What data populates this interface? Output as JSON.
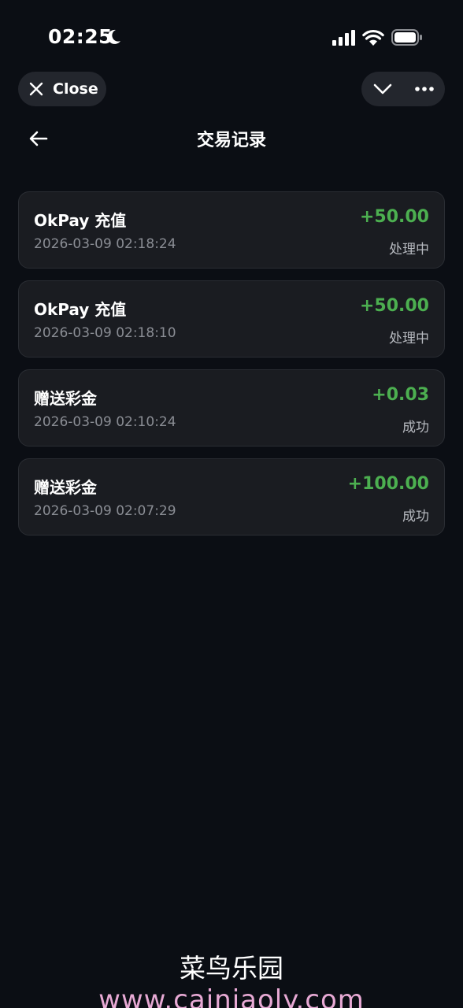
{
  "status_bar": {
    "time": "02:25"
  },
  "top_bar": {
    "close_label": "Close"
  },
  "header": {
    "title": "交易记录"
  },
  "transactions": [
    {
      "title": "OkPay 充值",
      "time": "2026-03-09 02:18:24",
      "amount": "+50.00",
      "status": "处理中"
    },
    {
      "title": "OkPay 充值",
      "time": "2026-03-09 02:18:10",
      "amount": "+50.00",
      "status": "处理中"
    },
    {
      "title": "赠送彩金",
      "time": "2026-03-09 02:10:24",
      "amount": "+0.03",
      "status": "成功"
    },
    {
      "title": "赠送彩金",
      "time": "2026-03-09 02:07:29",
      "amount": "+100.00",
      "status": "成功"
    }
  ],
  "watermark": {
    "name": "菜鸟乐园",
    "url": "www.cainiaoly.com"
  },
  "colors": {
    "background": "#0b0e14",
    "card": "#1a1c21",
    "amount_positive": "#4caf50",
    "watermark_url": "#e7a9d4"
  },
  "icons": [
    "moon-icon",
    "signal-icon",
    "wifi-icon",
    "battery-icon",
    "close-icon",
    "chevron-down-icon",
    "more-icon",
    "back-arrow-icon"
  ]
}
